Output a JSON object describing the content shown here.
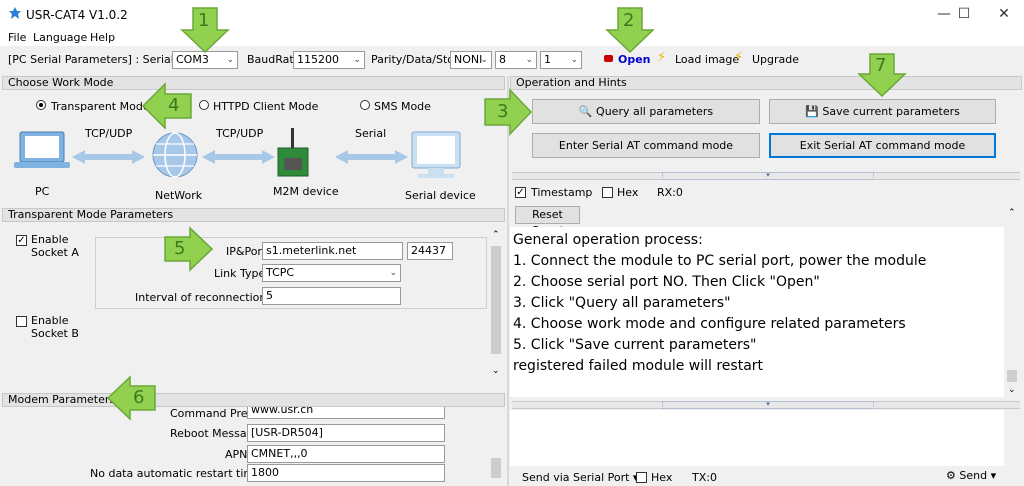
{
  "window": {
    "title": "USR-CAT4 V1.0.2",
    "minimize": "—",
    "maximize": "☐",
    "close": "✕"
  },
  "menu": {
    "file": "File",
    "language": "Language",
    "help": "Help"
  },
  "toolbar": {
    "serial_params_label": "[PC Serial Parameters] : Serial Port",
    "serial_port": "COM3",
    "baudrate_label": "BaudRate",
    "baudrate": "115200",
    "pds_label": "Parity/Data/Stop",
    "parity": "NONI",
    "data_bits": "8",
    "stop_bits": "1",
    "open_label": "Open",
    "load_image_label": "Load image",
    "upgrade_label": "Upgrade",
    "open_color": "#0000cc",
    "open_led_color": "#cc0000"
  },
  "work_mode": {
    "header": "Choose Work Mode",
    "options": [
      "Transparent Mode",
      "HTTPD Client Mode",
      "SMS Mode"
    ],
    "selected": "Transparent Mode",
    "diagram": {
      "pc": "PC",
      "network": "NetWork",
      "m2m": "M2M device",
      "serial_device": "Serial device",
      "link1": "TCP/UDP",
      "link2": "TCP/UDP",
      "link3": "Serial"
    }
  },
  "transparent": {
    "header": "Transparent Mode Parameters",
    "socket_a_label": "Enable\nSocket A",
    "socket_a_line1": "Enable",
    "socket_a_line2": "Socket A",
    "socket_a_checked": true,
    "ip_port_label": "IP&Port",
    "ip_value": "s1.meterlink.net",
    "port_value": "24437",
    "link_type_label": "Link Type",
    "link_type": "TCPC",
    "reconnect_label": "Interval of reconnection(s)",
    "reconnect_value": "5",
    "socket_b_line1": "Enable",
    "socket_b_line2": "Socket B",
    "socket_b_checked": false
  },
  "modem": {
    "header": "Modem Parameters",
    "command_prefix_label": "Command Prefix",
    "command_prefix_value": "www.usr.cn",
    "reboot_label": "Reboot Message",
    "reboot_value": "[USR-DR504]",
    "apn_label": "APN",
    "apn_value": "CMNET,,,0",
    "restart_label": "No data automatic restart time(s)",
    "restart_value": "1800"
  },
  "operation": {
    "header": "Operation and Hints",
    "query_label": "Query all parameters",
    "save_label": "Save current parameters",
    "enter_at_label": "Enter Serial AT command mode",
    "exit_at_label": "Exit Serial AT command mode"
  },
  "log": {
    "timestamp_label": "Timestamp",
    "timestamp_checked": true,
    "hex_label": "Hex",
    "rx_label": "RX:0",
    "reset_label": "Reset Count",
    "lines": [
      "General operation process:",
      "1. Connect the module to PC serial port, power the module",
      "2. Choose serial port NO. Then Click \"Open\"",
      "3. Click \"Query all parameters\"",
      "4. Choose work mode and configure related parameters",
      "5. Click \"Save current parameters\"",
      "registered failed module will restart"
    ]
  },
  "send": {
    "via_label": "Send via Serial Port",
    "hex_label": "Hex",
    "tx_label": "TX:0",
    "send_label": "Send"
  },
  "callouts": [
    "1",
    "2",
    "3",
    "4",
    "5",
    "6",
    "7"
  ],
  "colors": {
    "callout_fill": "#92d050",
    "callout_stroke": "#6aa838",
    "accent_border": "#0078d7"
  }
}
